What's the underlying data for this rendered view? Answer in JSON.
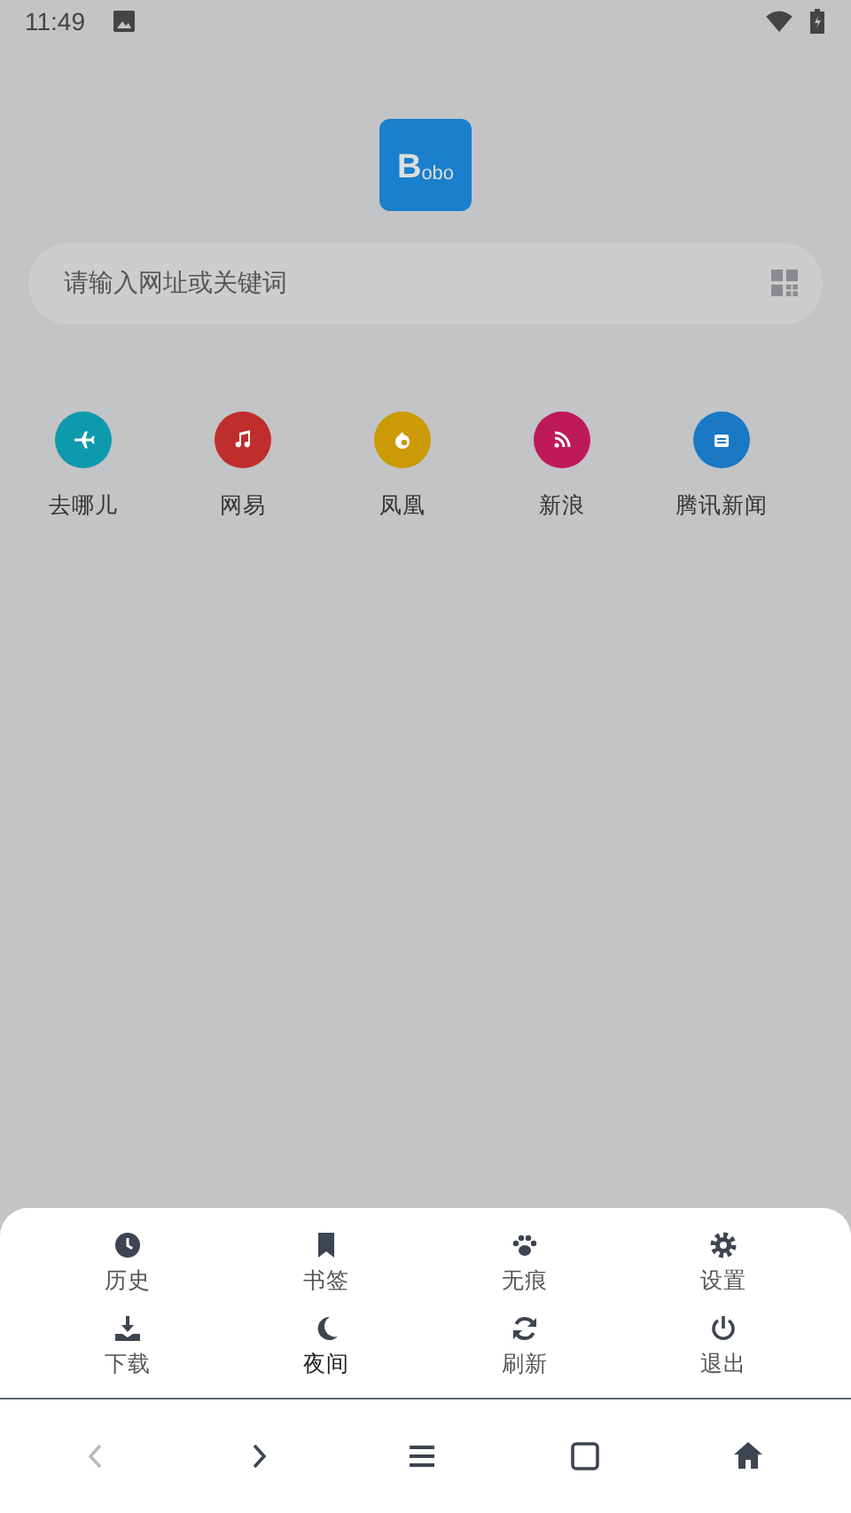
{
  "status_bar": {
    "time": "11:49"
  },
  "logo": {
    "initial": "B",
    "rest": "obo"
  },
  "search": {
    "placeholder": "请输入网址或关键词"
  },
  "shortcuts": [
    {
      "label": "去哪儿",
      "color": "#0e9aad",
      "kind": "plane"
    },
    {
      "label": "网易",
      "color": "#bf2e2c",
      "kind": "music"
    },
    {
      "label": "凤凰",
      "color": "#cc9a06",
      "kind": "flame"
    },
    {
      "label": "新浪",
      "color": "#bd1a55",
      "kind": "rss"
    },
    {
      "label": "腾讯新闻",
      "color": "#1a78c4",
      "kind": "news"
    }
  ],
  "menu": [
    {
      "label": "历史",
      "kind": "clock",
      "active": false
    },
    {
      "label": "书签",
      "kind": "bookmark",
      "active": false
    },
    {
      "label": "无痕",
      "kind": "paw",
      "active": false
    },
    {
      "label": "设置",
      "kind": "gear",
      "active": false
    },
    {
      "label": "下载",
      "kind": "download",
      "active": false
    },
    {
      "label": "夜间",
      "kind": "moon",
      "active": true
    },
    {
      "label": "刷新",
      "kind": "refresh",
      "active": false
    },
    {
      "label": "退出",
      "kind": "power",
      "active": false
    }
  ],
  "nav": [
    {
      "kind": "back",
      "disabled": true
    },
    {
      "kind": "forward",
      "disabled": false
    },
    {
      "kind": "menu",
      "disabled": false
    },
    {
      "kind": "tabs",
      "disabled": false
    },
    {
      "kind": "home",
      "disabled": false
    }
  ]
}
